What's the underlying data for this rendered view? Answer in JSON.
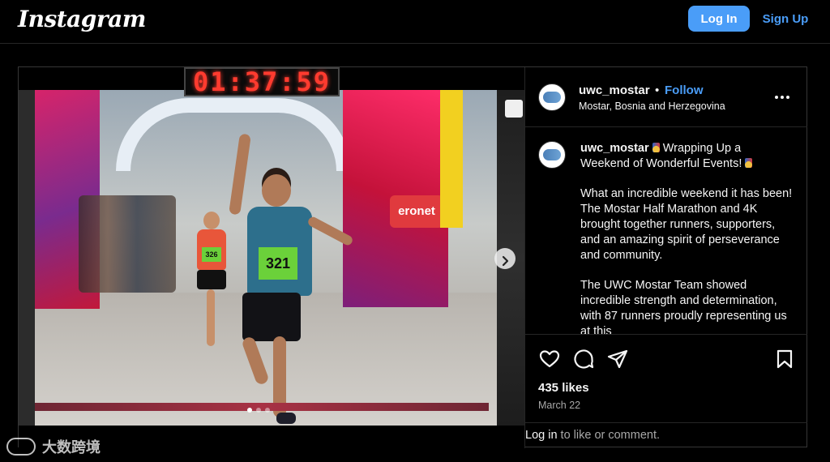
{
  "header": {
    "logo_text": "Instagram",
    "login_label": "Log In",
    "signup_label": "Sign Up"
  },
  "media": {
    "clock_text": "01:37:59",
    "runner_bib": "321",
    "second_runner_bib": "326",
    "sponsor_text": "eronet",
    "carousel": {
      "dot_count": 3,
      "active_index": 0
    }
  },
  "post": {
    "username": "uwc_mostar",
    "separator": "•",
    "follow_label": "Follow",
    "location": "Mostar, Bosnia and Herzegovina",
    "caption_paragraphs": [
      "Wrapping Up a Weekend of Wonderful Events!",
      "What an incredible weekend it has been! The Mostar Half Marathon and 4K brought together runners, supporters, and an amazing spirit of perseverance and community.",
      "The UWC Mostar Team showed incredible strength and determination, with 87 runners proudly representing us at this"
    ],
    "likes": "435 likes",
    "date": "March 22",
    "login_prompt_link": "Log in",
    "login_prompt_rest": " to like or comment."
  },
  "watermark": {
    "text": "大数跨境"
  },
  "colors": {
    "accent_blue": "#4a9df8",
    "background": "#000000",
    "border": "#262626",
    "secondary_text": "#a8a8a8"
  }
}
